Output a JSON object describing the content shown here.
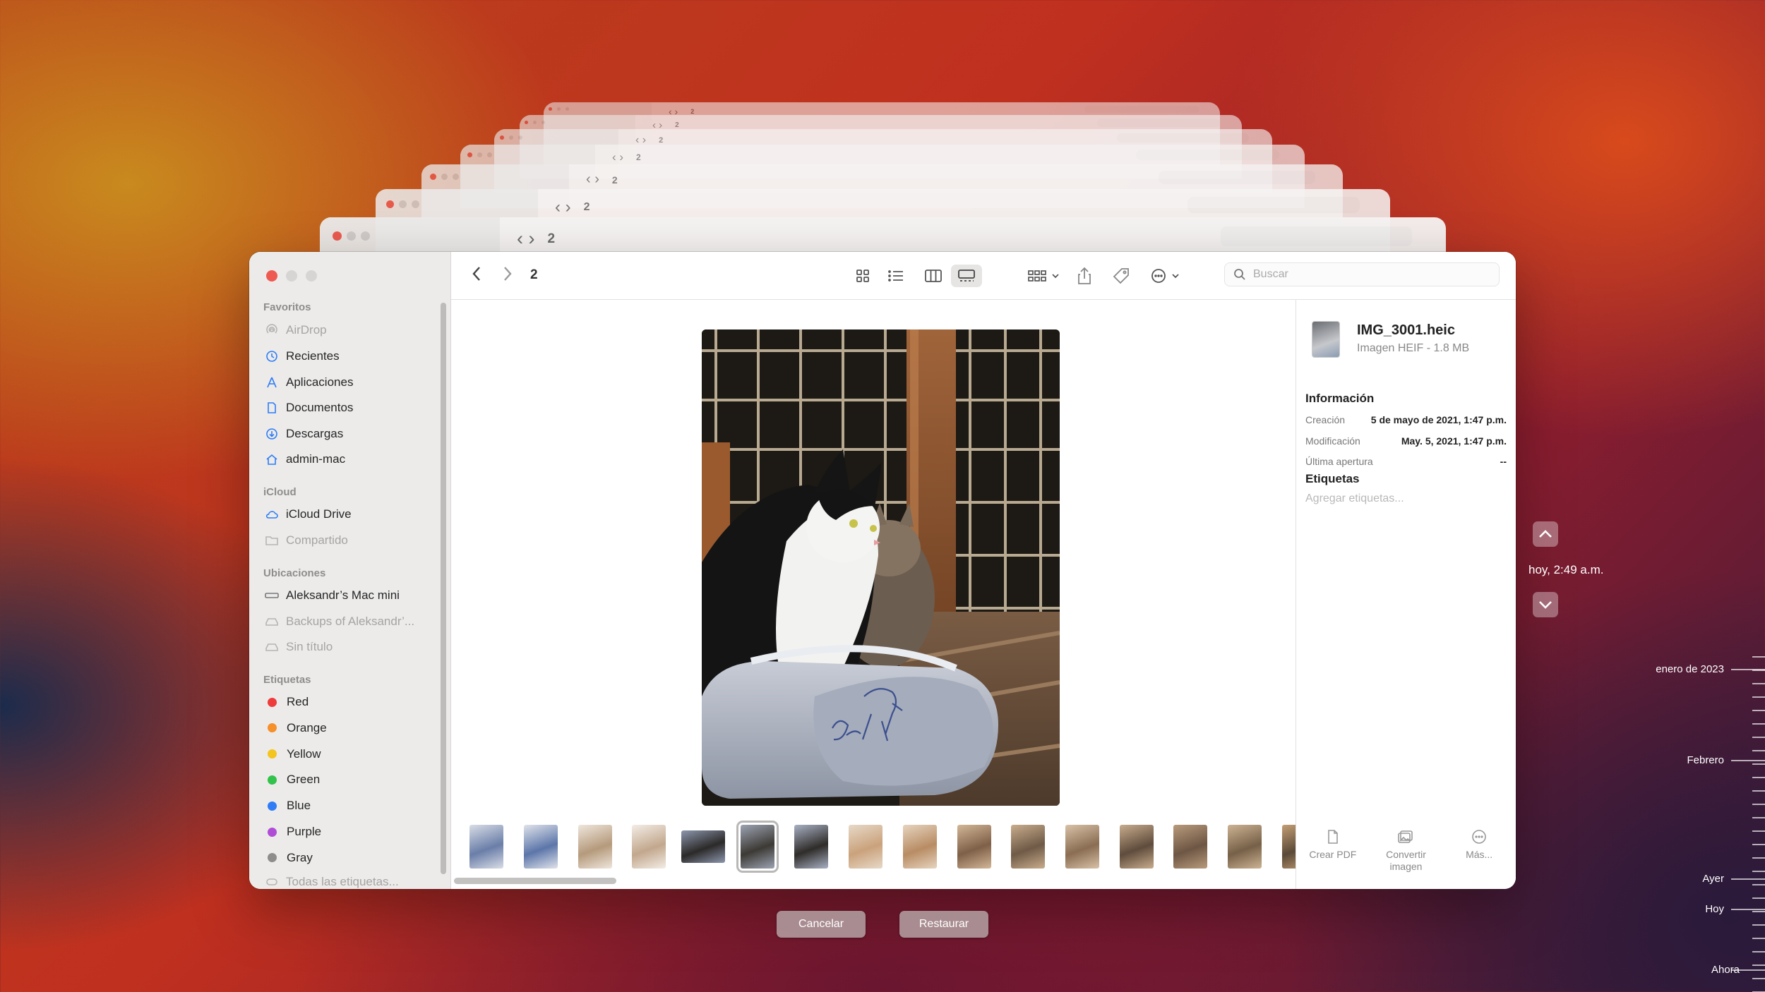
{
  "window": {
    "folder_title": "2"
  },
  "toolbar": {
    "search_placeholder": "Buscar"
  },
  "sidebar": {
    "favorites_title": "Favoritos",
    "favorites": [
      {
        "label": "AirDrop",
        "icon": "airdrop-icon",
        "dim": true
      },
      {
        "label": "Recientes",
        "icon": "clock-icon"
      },
      {
        "label": "Aplicaciones",
        "icon": "apps-icon"
      },
      {
        "label": "Documentos",
        "icon": "document-icon"
      },
      {
        "label": "Descargas",
        "icon": "download-icon"
      },
      {
        "label": "admin-mac",
        "icon": "home-icon"
      }
    ],
    "icloud_title": "iCloud",
    "icloud": [
      {
        "label": "iCloud Drive",
        "icon": "cloud-icon"
      },
      {
        "label": "Compartido",
        "icon": "shared-folder-icon",
        "dim": true
      }
    ],
    "locations_title": "Ubicaciones",
    "locations": [
      {
        "label": "Aleksandr’s Mac mini",
        "icon": "computer-icon"
      },
      {
        "label": "Backups of Aleksandr’...",
        "icon": "drive-icon",
        "dim": true
      },
      {
        "label": "Sin título",
        "icon": "drive-icon",
        "dim": true
      }
    ],
    "tags_title": "Etiquetas",
    "tags": [
      {
        "label": "Red",
        "color": "#ee3b3b"
      },
      {
        "label": "Orange",
        "color": "#f5902a"
      },
      {
        "label": "Yellow",
        "color": "#f3c51e"
      },
      {
        "label": "Green",
        "color": "#33c24b"
      },
      {
        "label": "Blue",
        "color": "#2f7cf6"
      },
      {
        "label": "Purple",
        "color": "#b04dd6"
      },
      {
        "label": "Gray",
        "color": "#8e8d8c"
      }
    ],
    "all_tags": "Todas las etiquetas..."
  },
  "inspector": {
    "file_name": "IMG_3001.heic",
    "file_type": "Imagen HEIF - 1.8 MB",
    "info_title": "Información",
    "rows": [
      {
        "key": "Creación",
        "value": "5 de mayo de 2021, 1:47 p.m."
      },
      {
        "key": "Modificación",
        "value": "May. 5, 2021, 1:47 p.m."
      },
      {
        "key": "Última apertura",
        "value": "--"
      }
    ],
    "tags_title": "Etiquetas",
    "tags_placeholder": "Agregar etiquetas...",
    "actions": [
      {
        "label": "Crear PDF",
        "icon": "pdf-icon"
      },
      {
        "label": "Convertir imagen",
        "icon": "convert-image-icon"
      },
      {
        "label": "Más...",
        "icon": "more-icon"
      }
    ]
  },
  "buttons": {
    "cancel": "Cancelar",
    "restore": "Restaurar"
  },
  "timemachine": {
    "current_label": "hoy, 2:49 a.m.",
    "timeline_labels": [
      "enero de 2023",
      "Febrero",
      "Ayer",
      "Hoy",
      "Ahora"
    ]
  }
}
